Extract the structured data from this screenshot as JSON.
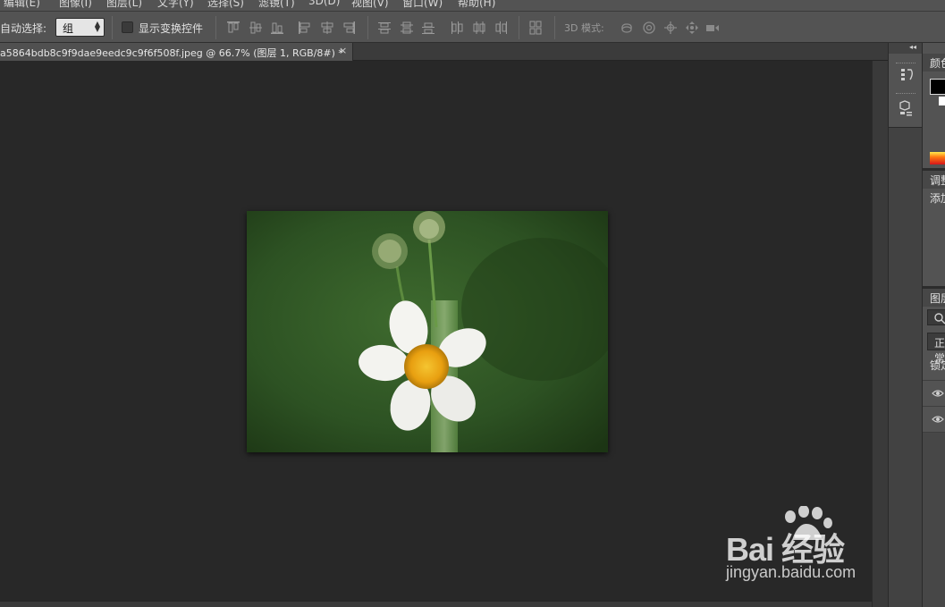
{
  "menubar": {
    "items": [
      "编辑(E)",
      "图像(I)",
      "图层(L)",
      "文字(Y)",
      "选择(S)",
      "滤镜(T)",
      "3D(D)",
      "视图(V)",
      "窗口(W)",
      "帮助(H)"
    ]
  },
  "options": {
    "auto_select_label": "自动选择:",
    "auto_select_value": "组",
    "show_transform_label": "显示变换控件",
    "mode_3d_label": "3D 模式:"
  },
  "document": {
    "tab_label": "a5864bdb8c9f9dae9eedc9c9f6f508f.jpeg @ 66.7% (图层 1, RGB/8#) *",
    "close_glyph": "×"
  },
  "panels": {
    "color_title": "颜色",
    "adjustments_title": "调整",
    "adjustments_add": "添加",
    "layers_title": "图层",
    "blend_mode": "正常",
    "lock_label": "锁定",
    "collapse_glyph": "◂◂"
  },
  "watermark": {
    "brand": "Bai 经验",
    "url": "jingyan.baidu.com"
  },
  "colors": {
    "foreground": "#000000",
    "background": "#ffffff",
    "ui_panel": "#535353",
    "canvas_bg": "#282828"
  },
  "icons": [
    "align-top-icon",
    "align-vcenter-icon",
    "align-bottom-icon",
    "align-left-icon",
    "align-hcenter-icon",
    "align-right-icon",
    "distribute-top-icon",
    "distribute-vcenter-icon",
    "distribute-bottom-icon",
    "distribute-left-icon",
    "distribute-hcenter-icon",
    "distribute-right-icon",
    "auto-align-icon",
    "3d-rotate-icon",
    "3d-roll-icon",
    "3d-pan-icon",
    "3d-slide-icon",
    "3d-scale-icon",
    "eye-icon"
  ]
}
